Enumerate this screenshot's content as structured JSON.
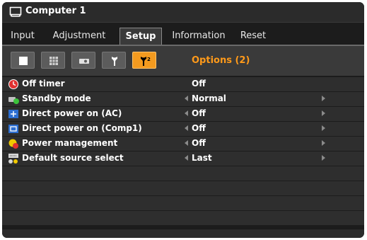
{
  "window": {
    "title": "Computer 1"
  },
  "tabs": [
    {
      "label": "Input"
    },
    {
      "label": "Adjustment"
    },
    {
      "label": "Setup",
      "active": true
    },
    {
      "label": "Information"
    },
    {
      "label": "Reset"
    }
  ],
  "subtabs": {
    "icons": [
      "screen-icon",
      "grid-icon",
      "projector-icon",
      "wrench-icon",
      "options-icon"
    ],
    "active_index": 4,
    "title": "Options (2)"
  },
  "rows": [
    {
      "label": "Off timer",
      "value": "Off",
      "icon": "clock-icon",
      "has_arrows": false
    },
    {
      "label": "Standby mode",
      "value": "Normal",
      "icon": "standby-icon",
      "has_arrows": true
    },
    {
      "label": "Direct power on (AC)",
      "value": "Off",
      "icon": "power-ac-icon",
      "has_arrows": true
    },
    {
      "label": "Direct power on (Comp1)",
      "value": "Off",
      "icon": "power-comp-icon",
      "has_arrows": true
    },
    {
      "label": "Power management",
      "value": "Off",
      "icon": "power-management-icon",
      "has_arrows": true
    },
    {
      "label": "Default source select",
      "value": "Last",
      "icon": "source-select-icon",
      "has_arrows": true
    }
  ],
  "colors": {
    "accent": "#f39a1f",
    "accent_text": "#ff9a1a",
    "background": "#1c1c1c",
    "row": "#2e2e2e"
  }
}
